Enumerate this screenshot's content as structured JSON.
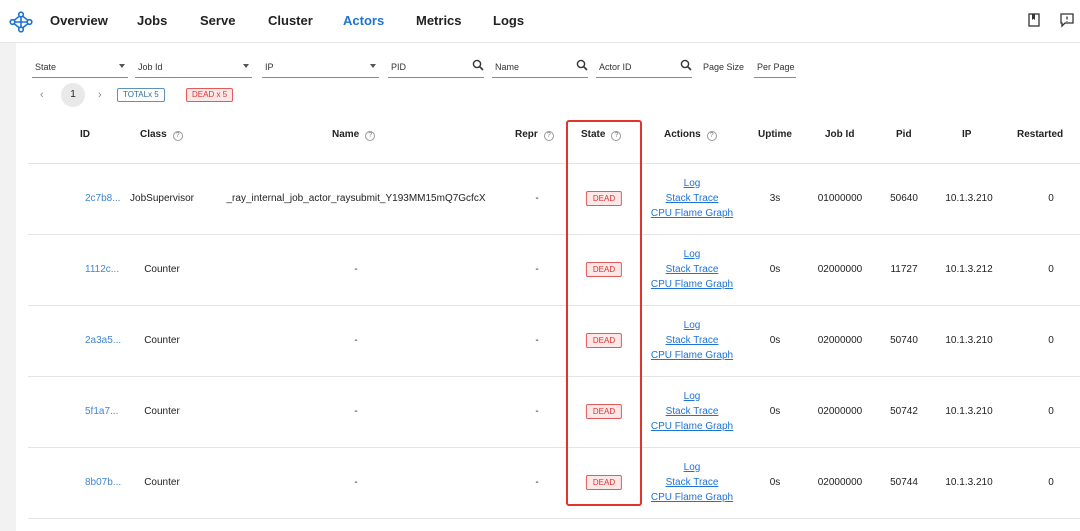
{
  "nav": {
    "items": [
      "Overview",
      "Jobs",
      "Serve",
      "Cluster",
      "Actors",
      "Metrics",
      "Logs"
    ],
    "active": "Actors"
  },
  "filters": {
    "state": "State",
    "job_id": "Job Id",
    "ip": "IP",
    "pid": "PID",
    "name": "Name",
    "actor_id": "Actor ID",
    "page_size_label": "Page Size",
    "per_page": "Per Page"
  },
  "pager": {
    "prev": "‹",
    "page": "1",
    "next": "›"
  },
  "tags": {
    "total": "TOTALx 5",
    "dead": "DEAD x 5"
  },
  "table": {
    "headers": {
      "id": "ID",
      "class": "Class",
      "name": "Name",
      "repr": "Repr",
      "state": "State",
      "actions": "Actions",
      "uptime": "Uptime",
      "job_id": "Job Id",
      "pid": "Pid",
      "ip": "IP",
      "restarted": "Restarted"
    },
    "rows": [
      {
        "id": "2c7b8...",
        "class": "JobSupervisor",
        "name": "_ray_internal_job_actor_raysubmit_Y193MM15mQ7GcfcX",
        "repr": "-",
        "state": "DEAD",
        "actions": [
          "Log",
          "Stack Trace",
          "CPU Flame Graph"
        ],
        "uptime": "3s",
        "job_id": "01000000",
        "pid": "50640",
        "ip": "10.1.3.210",
        "restarted": "0"
      },
      {
        "id": "1112c...",
        "class": "Counter",
        "name": "-",
        "repr": "-",
        "state": "DEAD",
        "actions": [
          "Log",
          "Stack Trace",
          "CPU Flame Graph"
        ],
        "uptime": "0s",
        "job_id": "02000000",
        "pid": "11727",
        "ip": "10.1.3.212",
        "restarted": "0"
      },
      {
        "id": "2a3a5...",
        "class": "Counter",
        "name": "-",
        "repr": "-",
        "state": "DEAD",
        "actions": [
          "Log",
          "Stack Trace",
          "CPU Flame Graph"
        ],
        "uptime": "0s",
        "job_id": "02000000",
        "pid": "50740",
        "ip": "10.1.3.210",
        "restarted": "0"
      },
      {
        "id": "5f1a7...",
        "class": "Counter",
        "name": "-",
        "repr": "-",
        "state": "DEAD",
        "actions": [
          "Log",
          "Stack Trace",
          "CPU Flame Graph"
        ],
        "uptime": "0s",
        "job_id": "02000000",
        "pid": "50742",
        "ip": "10.1.3.210",
        "restarted": "0"
      },
      {
        "id": "8b07b...",
        "class": "Counter",
        "name": "-",
        "repr": "-",
        "state": "DEAD",
        "actions": [
          "Log",
          "Stack Trace",
          "CPU Flame Graph"
        ],
        "uptime": "0s",
        "job_id": "02000000",
        "pid": "50744",
        "ip": "10.1.3.210",
        "restarted": "0"
      }
    ]
  },
  "colors": {
    "accent": "#1d73d6",
    "dead": "#d33333",
    "highlight": "#e0342c"
  },
  "icons": [
    "ray-logo-icon",
    "book-icon",
    "feedback-icon",
    "search-icon",
    "help-icon",
    "chevron-down-icon"
  ]
}
